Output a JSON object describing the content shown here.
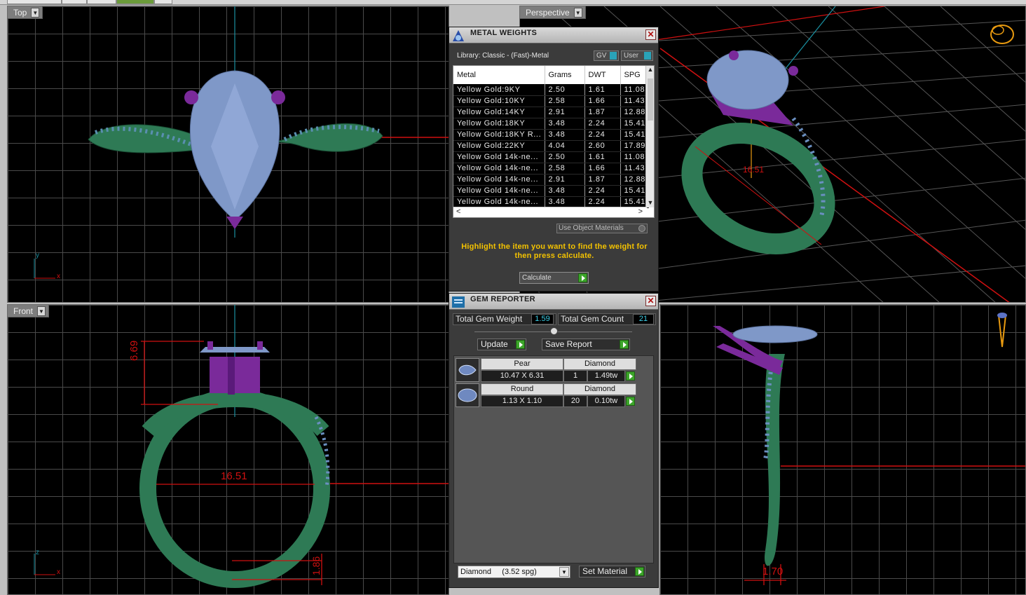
{
  "viewports": {
    "top": {
      "label": "Top",
      "axis_y": "y",
      "axis_x": "x"
    },
    "perspective": {
      "label": "Perspective",
      "dim": "16.51"
    },
    "front": {
      "label": "Front",
      "axis_z": "z",
      "axis_x": "x",
      "dim_height": "6.69",
      "dim_width": "16.51",
      "dim_band": "1.86"
    },
    "side": {
      "dim_width": "1.70"
    }
  },
  "metal_weights": {
    "title": "METAL WEIGHTS",
    "library": "Library: Classic - (Fast)-Metal",
    "gv_label": "GV",
    "user_label": "User",
    "columns": [
      "Metal",
      "Grams",
      "DWT",
      "SPG"
    ],
    "rows": [
      [
        "Yellow Gold:9KY",
        "2.50",
        "1.61",
        "11.08"
      ],
      [
        "Yellow Gold:10KY",
        "2.58",
        "1.66",
        "11.43"
      ],
      [
        "Yellow Gold:14KY",
        "2.91",
        "1.87",
        "12.88"
      ],
      [
        "Yellow Gold:18KY",
        "3.48",
        "2.24",
        "15.41"
      ],
      [
        "Yellow Gold:18KY R...",
        "3.48",
        "2.24",
        "15.41"
      ],
      [
        "Yellow Gold:22KY",
        "4.04",
        "2.60",
        "17.89"
      ],
      [
        "Yellow Gold 14k-ne...",
        "2.50",
        "1.61",
        "11.08"
      ],
      [
        "Yellow Gold 14k-ne...",
        "2.58",
        "1.66",
        "11.43"
      ],
      [
        "Yellow Gold 14k-ne...",
        "2.91",
        "1.87",
        "12.88"
      ],
      [
        "Yellow Gold 14k-ne...",
        "3.48",
        "2.24",
        "15.41"
      ],
      [
        "Yellow Gold 14k-ne...",
        "3.48",
        "2.24",
        "15.41"
      ]
    ],
    "use_object_materials": "Use Object Materials",
    "hint": "Highlight the item you want to find the weight for then press calculate.",
    "calculate_label": "Calculate"
  },
  "gem_reporter": {
    "title": "GEM REPORTER",
    "total_weight_label": "Total Gem Weight",
    "total_weight_value": "1.59",
    "total_count_label": "Total Gem Count",
    "total_count_value": "21",
    "update_label": "Update",
    "save_report_label": "Save Report",
    "gems": [
      {
        "shape": "Pear",
        "material": "Diamond",
        "size": "10.47 X 6.31",
        "count": "1",
        "weight": "1.49tw"
      },
      {
        "shape": "Round",
        "material": "Diamond",
        "size": "1.13 X 1.10",
        "count": "20",
        "weight": "0.10tw"
      }
    ],
    "material_select": "Diamond     (3.52 spg)",
    "set_material_label": "Set Material"
  },
  "colors": {
    "metal": "#2e7a55",
    "gem": "#7f98c8",
    "prong": "#7a2a9a",
    "dimension": "#e01414",
    "axis": "#1a8fa0",
    "hint": "#f3c200"
  }
}
